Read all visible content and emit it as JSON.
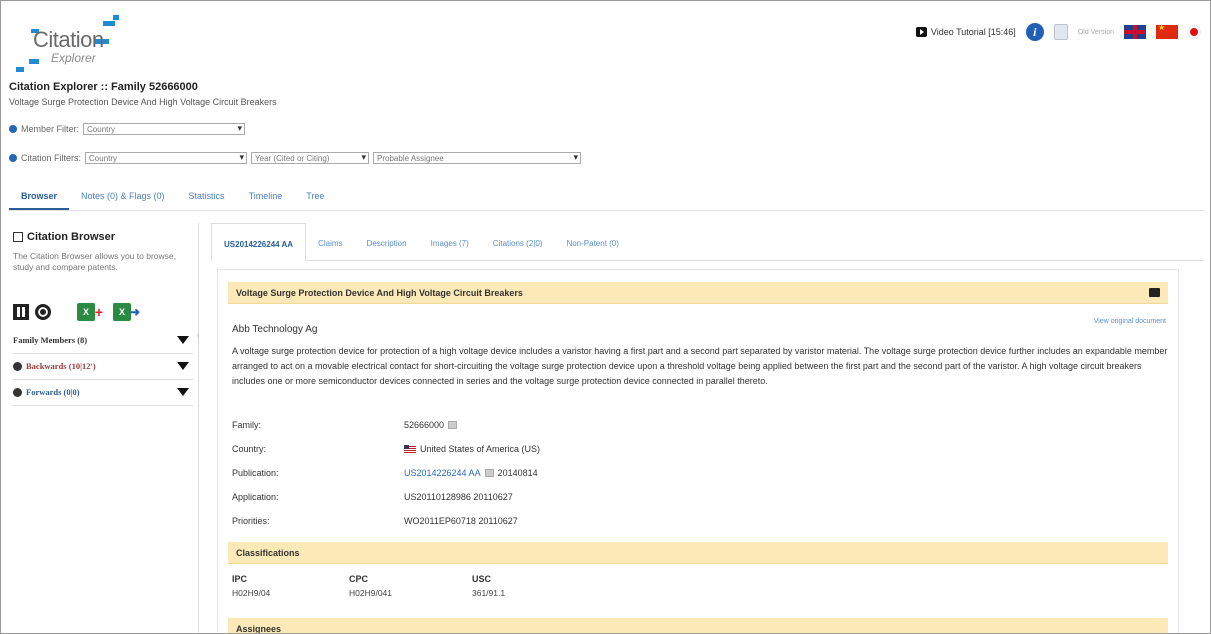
{
  "header": {
    "logo_text": "Citation",
    "logo_sub": "Explorer",
    "family_title": "Citation Explorer :: Family 52666000",
    "family_subtitle": "Voltage Surge Protection Device And High Voltage Circuit Breakers",
    "video_tutorial": "Video Tutorial [15:46]",
    "old_version": "Old Version"
  },
  "filters": {
    "member_label": "Member Filter:",
    "member_value": "Country",
    "citation_label": "Citation Filters:",
    "citation_country": "Country",
    "citation_year": "Year (Cited or Citing)",
    "citation_assignee": "Probable Assignee"
  },
  "main_tabs": [
    {
      "label": "Browser",
      "active": true
    },
    {
      "label": "Notes (0) & Flags (0)",
      "active": false
    },
    {
      "label": "Statistics",
      "active": false
    },
    {
      "label": "Timeline",
      "active": false
    },
    {
      "label": "Tree",
      "active": false
    }
  ],
  "sidebar": {
    "title": "Citation Browser",
    "description": "The Citation Browser allows you to browse, study and compare patents.",
    "family_members": "Family Members (8)",
    "backwards": "Backwards (10|12′)",
    "forwards": "Forwards (0|0)"
  },
  "doc_tabs": [
    {
      "label": "US2014226244 AA",
      "active": true
    },
    {
      "label": "Claims",
      "active": false
    },
    {
      "label": "Description",
      "active": false
    },
    {
      "label": "Images (7)",
      "active": false
    },
    {
      "label": "Citations (2|0)",
      "active": false
    },
    {
      "label": "Non-Patent (0)",
      "active": false
    }
  ],
  "document": {
    "title": "Voltage Surge Protection Device And High Voltage Circuit Breakers",
    "assignee": "Abb Technology Ag",
    "view_original": "View original document",
    "abstract": "A voltage surge protection device for protection of a high voltage device includes a varistor having a first part and a second part separated by varistor material. The voltage surge protection device further includes an expandable member arranged to act on a movable electrical contact for short-circuiting the voltage surge protection device upon a threshold voltage being applied between the first part and the second part of the varistor. A high voltage circuit breakers includes one or more semiconductor devices connected in series and the voltage surge protection device connected in parallel thereto.",
    "fields": {
      "family_label": "Family:",
      "family_value": "52666000",
      "country_label": "Country:",
      "country_value": "United States of America (US)",
      "publication_label": "Publication:",
      "publication_link": "US2014226244 AA",
      "publication_date": "20140814",
      "application_label": "Application:",
      "application_value": "US20110128986 20110627",
      "priorities_label": "Priorities:",
      "priorities_value": "WO2011EP60718 20110627"
    },
    "classifications_heading": "Classifications",
    "classifications": {
      "ipc_label": "IPC",
      "ipc_value": "H02H9/04",
      "cpc_label": "CPC",
      "cpc_value": "H02H9/041",
      "usc_label": "USC",
      "usc_value": "361/91.1"
    },
    "assignees_heading": "Assignees"
  },
  "colors": {
    "accent": "#2a5d9a",
    "band": "#fbe9b7",
    "link": "#2a6cc0"
  }
}
